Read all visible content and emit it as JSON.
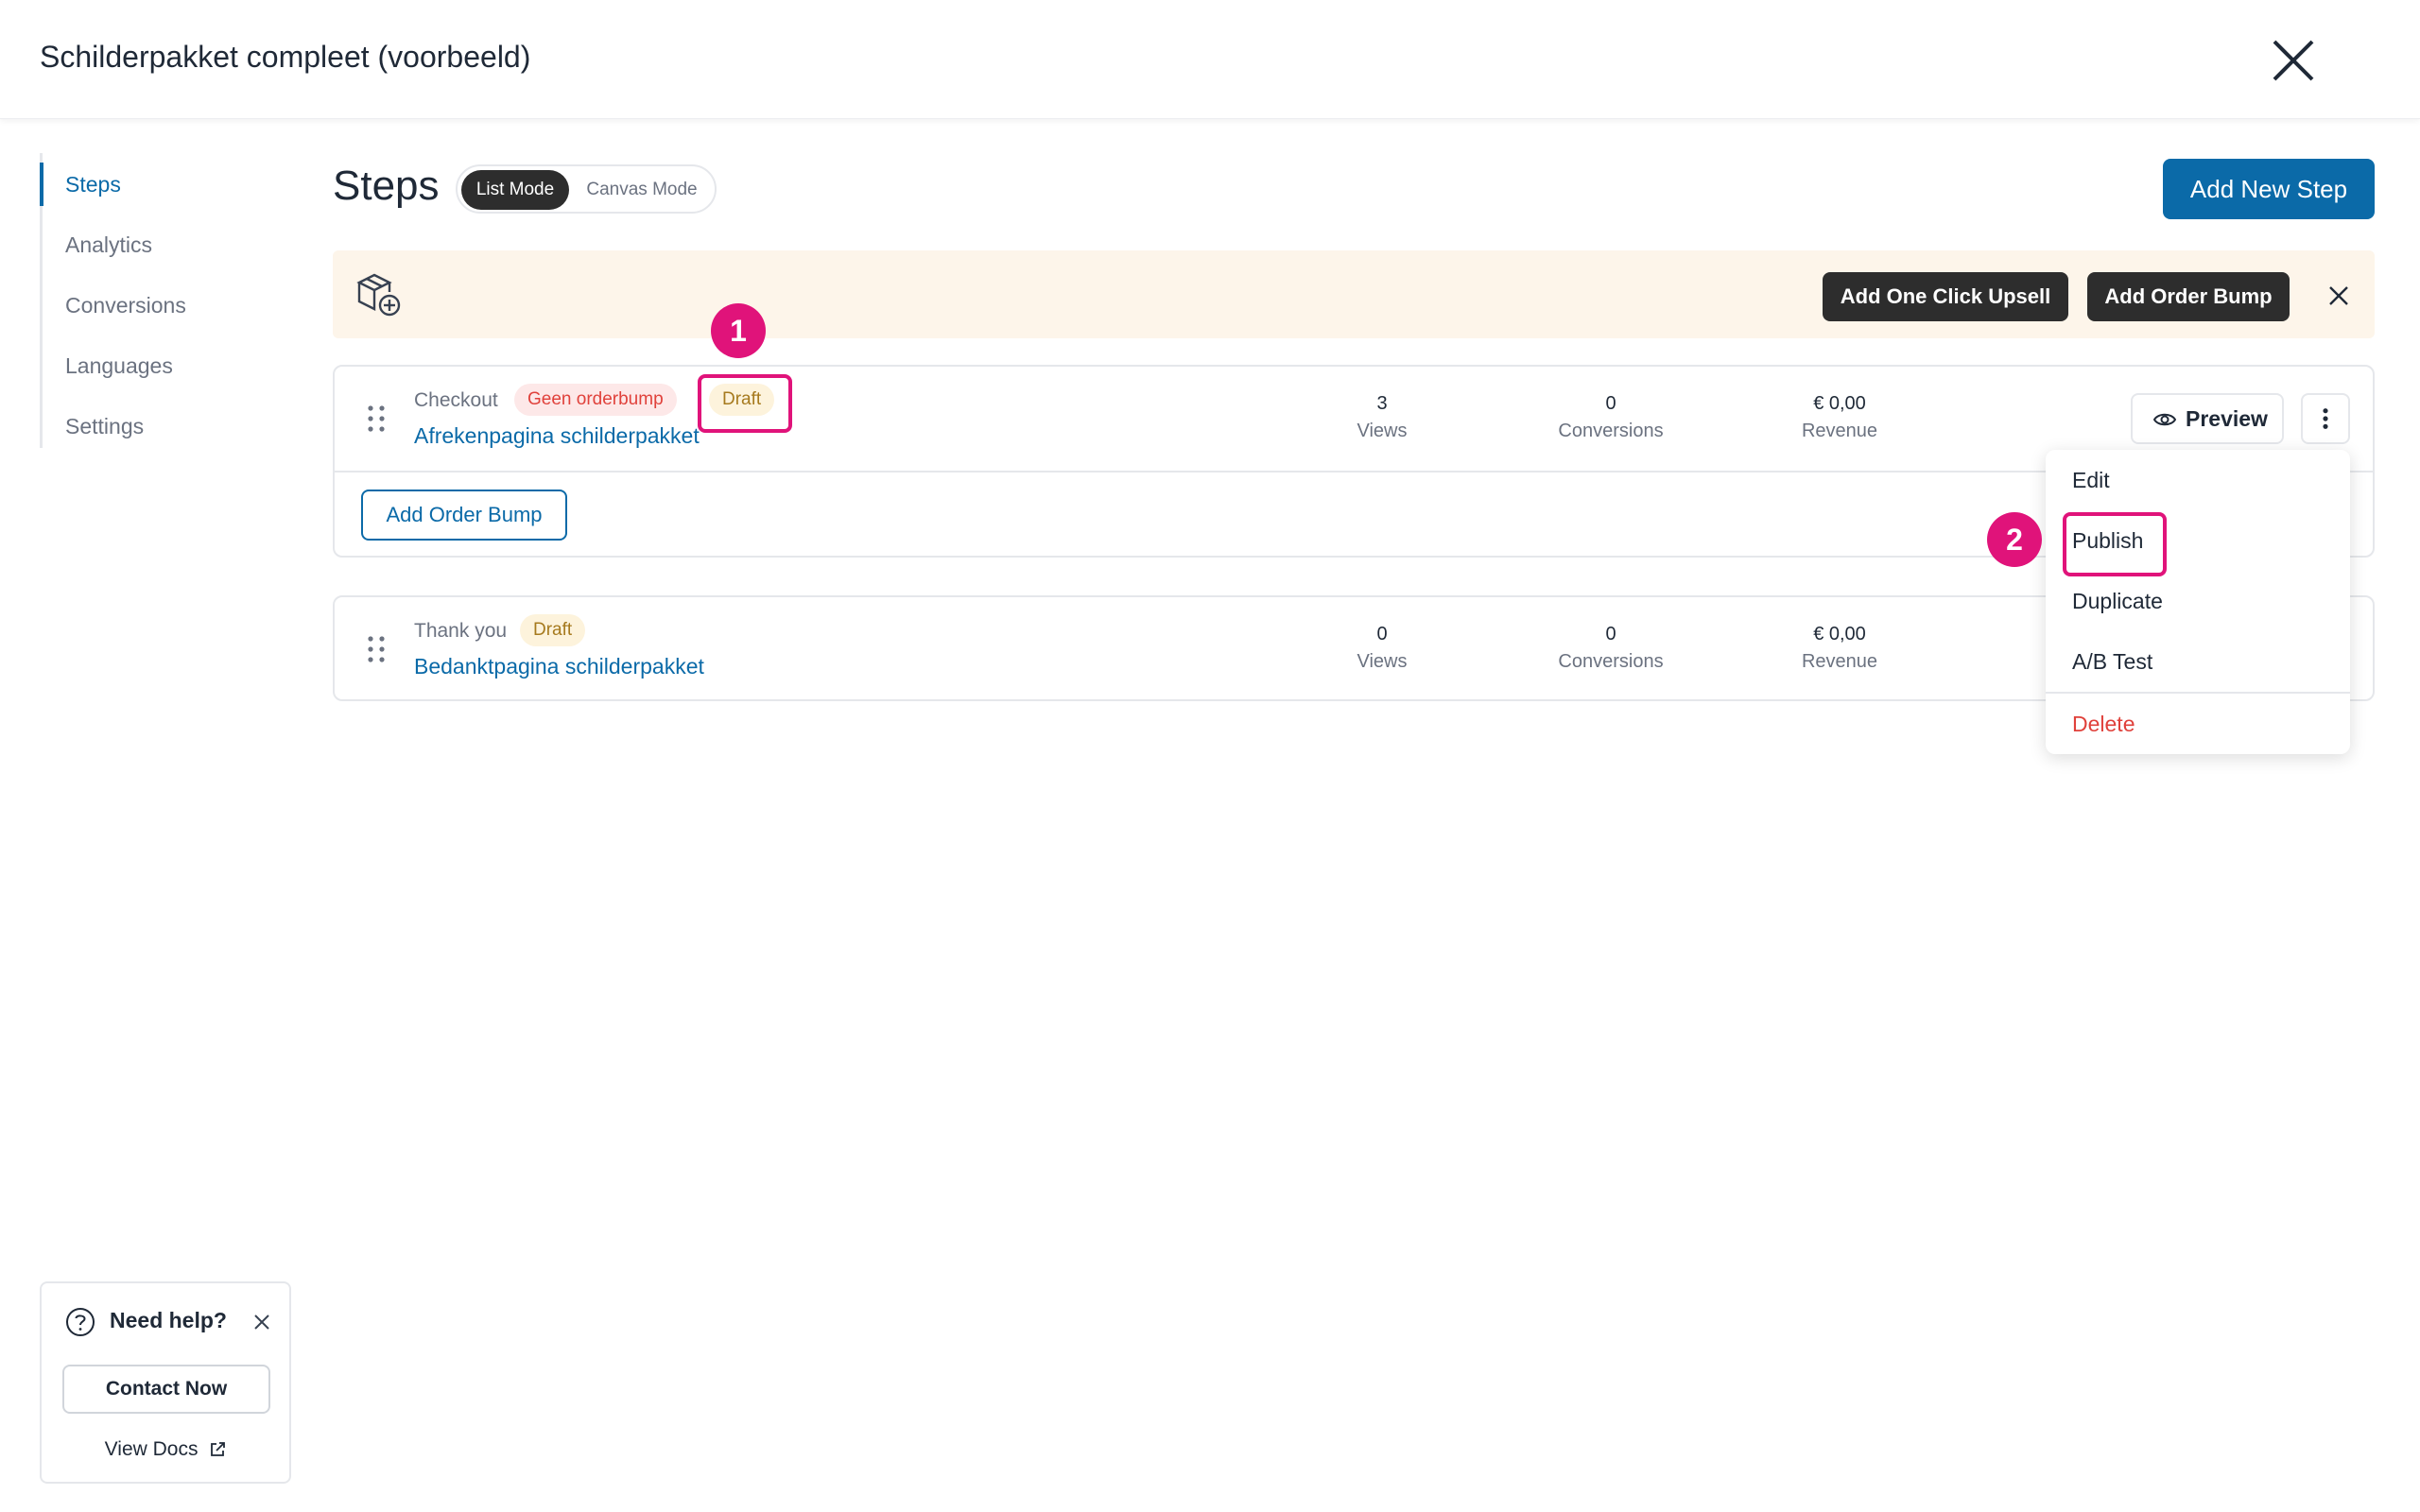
{
  "window": {
    "title": "Schilderpakket compleet (voorbeeld)"
  },
  "sidebar": {
    "items": [
      {
        "label": "Steps",
        "active": true
      },
      {
        "label": "Analytics"
      },
      {
        "label": "Conversions"
      },
      {
        "label": "Languages"
      },
      {
        "label": "Settings"
      }
    ]
  },
  "main": {
    "heading": "Steps",
    "modes": {
      "list": "List Mode",
      "canvas": "Canvas Mode",
      "selected": "List Mode"
    },
    "add_step_label": "Add New Step"
  },
  "banner": {
    "upsell_label": "Add One Click Upsell",
    "order_bump_label": "Add Order Bump"
  },
  "steps": [
    {
      "type": "Checkout",
      "tag": "Geen orderbump",
      "status": "Draft",
      "name": "Afrekenpagina schilderpakket",
      "views": "3",
      "views_label": "Views",
      "conversions": "0",
      "conversions_label": "Conversions",
      "revenue": "€ 0,00",
      "revenue_label": "Revenue",
      "add_order_bump_label": "Add Order Bump",
      "preview_label": "Preview"
    },
    {
      "type": "Thank you",
      "status": "Draft",
      "name": "Bedanktpagina schilderpakket",
      "views": "0",
      "views_label": "Views",
      "conversions": "0",
      "conversions_label": "Conversions",
      "revenue": "€ 0,00",
      "revenue_label": "Revenue"
    }
  ],
  "menu": {
    "items": [
      "Edit",
      "Publish",
      "Duplicate",
      "A/B Test",
      "Delete"
    ]
  },
  "annotations": {
    "badge1": "1",
    "badge2": "2"
  },
  "help": {
    "title": "Need help?",
    "contact_label": "Contact Now",
    "docs_label": "View Docs"
  },
  "colors": {
    "accent": "#0b6aa8",
    "highlight": "#e0137a",
    "danger": "#e0413b",
    "draft": "#a67a1e"
  }
}
